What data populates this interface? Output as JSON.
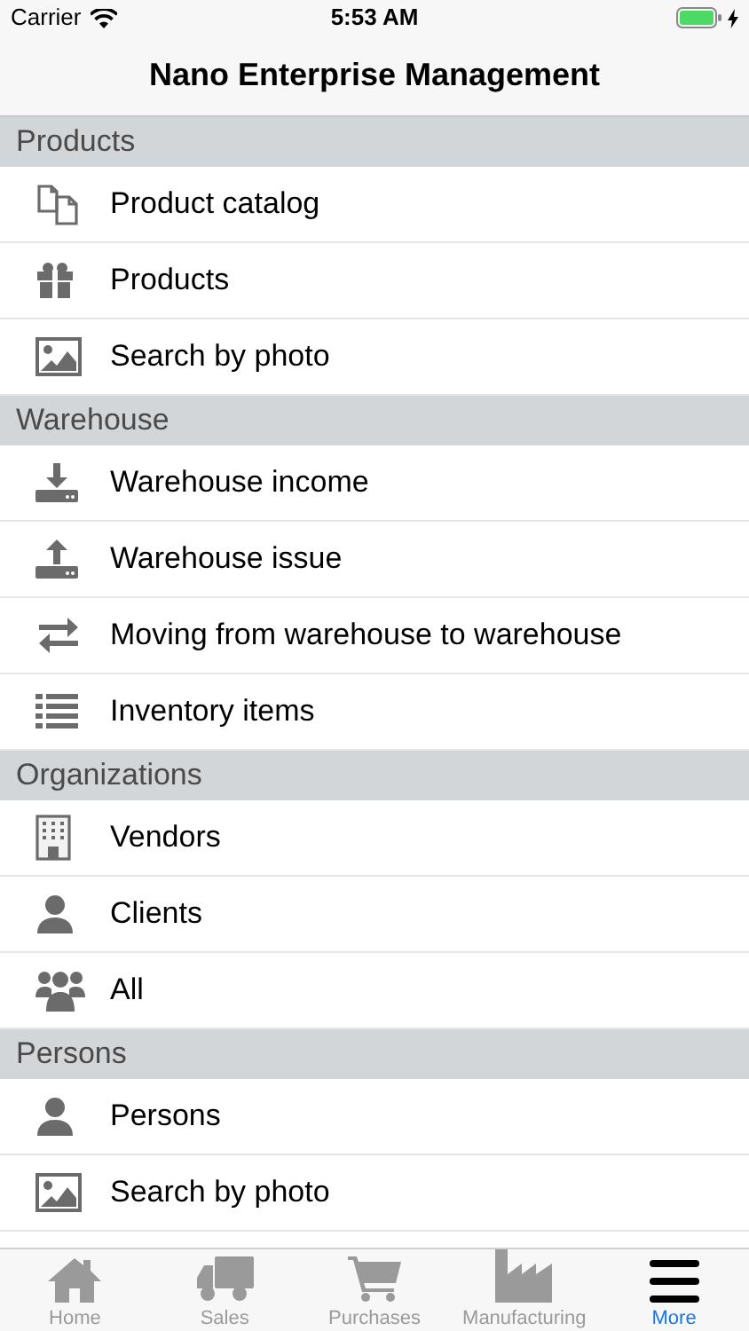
{
  "status_bar": {
    "carrier": "Carrier",
    "time": "5:53 AM"
  },
  "nav_bar": {
    "title": "Nano Enterprise Management"
  },
  "sections": [
    {
      "title": "Products",
      "items": [
        "Product catalog",
        "Products",
        "Search by photo"
      ]
    },
    {
      "title": "Warehouse",
      "items": [
        "Warehouse income",
        "Warehouse issue",
        "Moving from warehouse to warehouse",
        "Inventory items"
      ]
    },
    {
      "title": "Organizations",
      "items": [
        "Vendors",
        "Clients",
        "All"
      ]
    },
    {
      "title": "Persons",
      "items": [
        "Persons",
        "Search by photo"
      ]
    }
  ],
  "tab_bar": [
    {
      "label": "Home",
      "selected": false
    },
    {
      "label": "Sales",
      "selected": false
    },
    {
      "label": "Purchases",
      "selected": false
    },
    {
      "label": "Manufacturing",
      "selected": false
    },
    {
      "label": "More",
      "selected": true
    }
  ]
}
